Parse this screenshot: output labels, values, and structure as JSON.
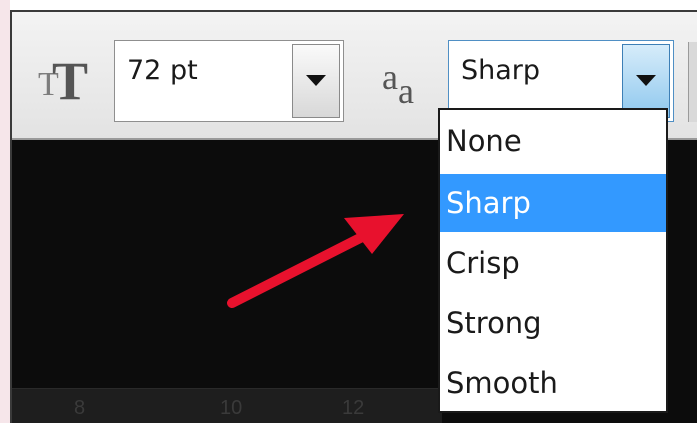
{
  "font_size": {
    "value": "72 pt"
  },
  "anti_aliasing": {
    "selected": "Sharp",
    "options": [
      "None",
      "Sharp",
      "Crisp",
      "Strong",
      "Smooth"
    ]
  },
  "ruler": {
    "labels": [
      "8",
      "10",
      "12"
    ]
  },
  "colors": {
    "highlight": "#3399ff",
    "arrow": "#e8112d"
  },
  "icons": {
    "font_size": "font-size-icon",
    "anti_alias": "anti-alias-icon",
    "dropdown": "chevron-down-icon"
  }
}
